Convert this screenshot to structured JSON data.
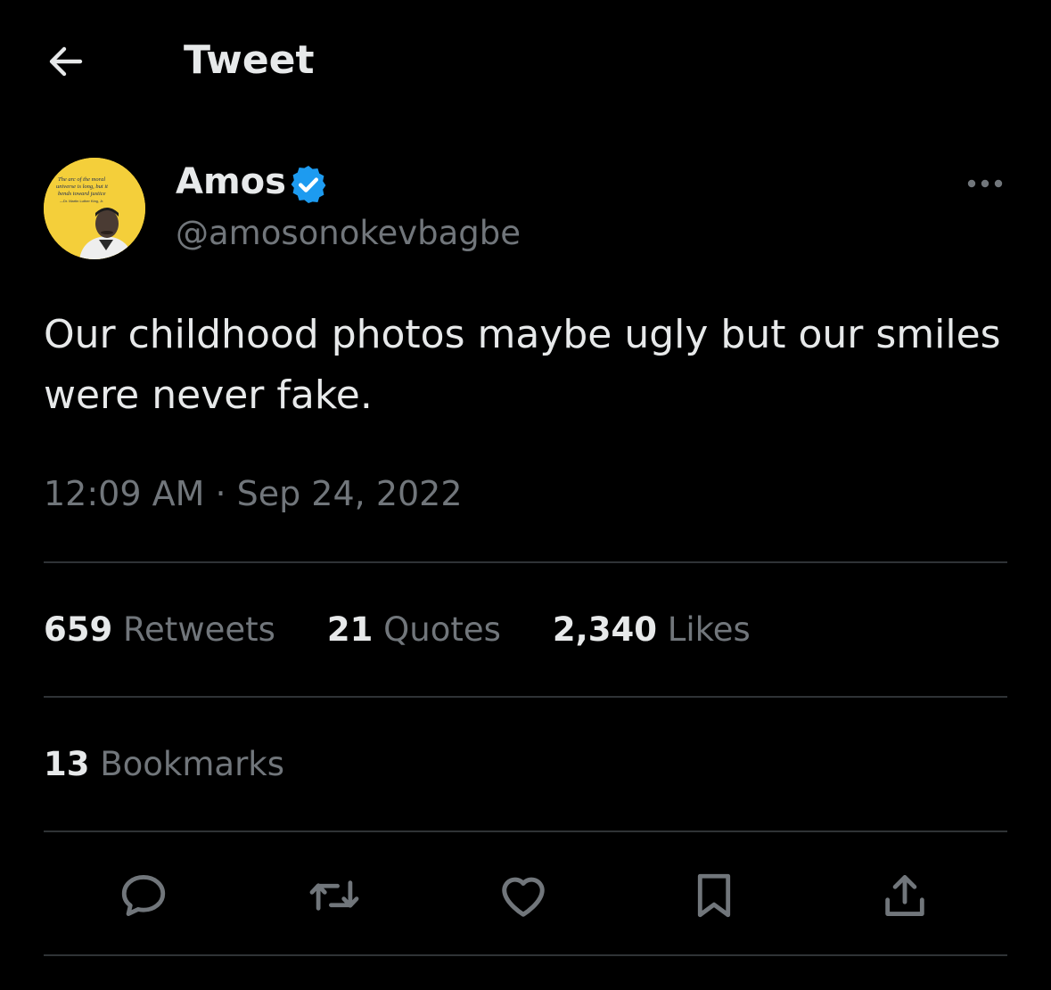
{
  "header": {
    "title": "Tweet",
    "back_icon": "arrow-left-icon"
  },
  "author": {
    "name": "Amos",
    "handle": "@amosonokevbagbe",
    "verified": true,
    "verified_color": "#1d9bf0",
    "avatar_quote": [
      "The arc of the moral",
      "universe is long, but it",
      "bends toward justice",
      "—Dr. Martin Luther King, Jr."
    ]
  },
  "tweet": {
    "text": "Our childhood photos maybe ugly but our smiles were never fake.",
    "timestamp": "12:09 AM · Sep 24, 2022"
  },
  "stats": {
    "retweets_count": "659",
    "retweets_label": "Retweets",
    "quotes_count": "21",
    "quotes_label": "Quotes",
    "likes_count": "2,340",
    "likes_label": "Likes",
    "bookmarks_count": "13",
    "bookmarks_label": "Bookmarks"
  },
  "actions": [
    "reply-icon",
    "retweet-icon",
    "like-icon",
    "bookmark-icon",
    "share-icon"
  ],
  "colors": {
    "background": "#000000",
    "primary_text": "#e7e9ea",
    "secondary_text": "#71767b",
    "divider": "#2f3336",
    "accent": "#1d9bf0",
    "avatar_bg": "#f4cf3a"
  }
}
